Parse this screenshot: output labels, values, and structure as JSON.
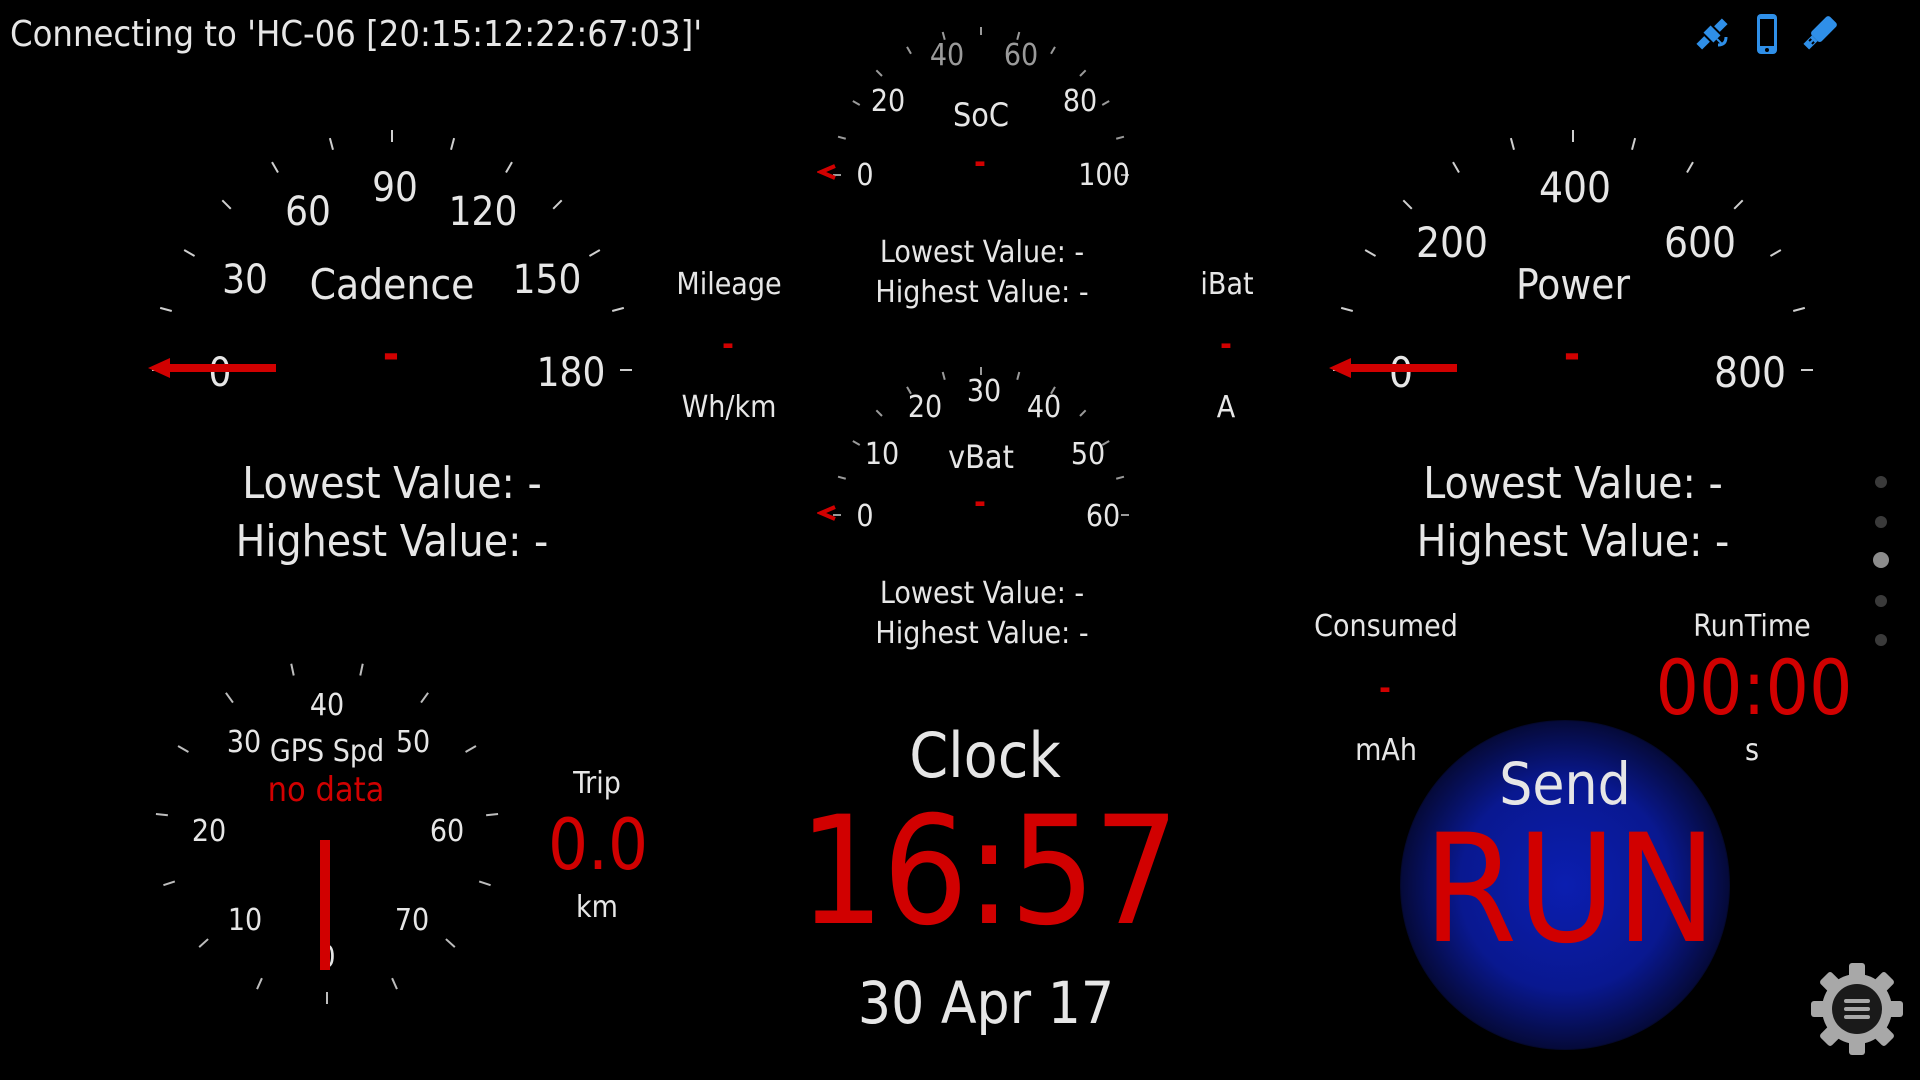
{
  "status": {
    "text": "Connecting to 'HC-06 [20:15:12:22:67:03]'"
  },
  "icons": [
    "satellite-icon",
    "phone-icon",
    "bluetooth-icon",
    "settings-gear-icon"
  ],
  "colors": {
    "accent_red": "#d10000",
    "bg": "#000000",
    "run_blue": "#0b1eb0"
  },
  "cadence": {
    "label": "Cadence",
    "ticks": [
      "0",
      "30",
      "60",
      "90",
      "120",
      "150",
      "180"
    ],
    "value": "-",
    "lowest": "Lowest Value: -",
    "highest": "Highest Value: -"
  },
  "soc": {
    "label": "SoC",
    "ticks": [
      "0",
      "20",
      "40",
      "60",
      "80",
      "100"
    ],
    "value": "-",
    "lowest": "Lowest Value: -",
    "highest": "Highest Value: -"
  },
  "vbat": {
    "label": "vBat",
    "ticks": [
      "0",
      "10",
      "20",
      "30",
      "40",
      "50",
      "60"
    ],
    "value": "-",
    "lowest": "Lowest Value: -",
    "highest": "Highest Value: -"
  },
  "mileage": {
    "label": "Mileage",
    "value": "-",
    "unit": "Wh/km"
  },
  "ibat": {
    "label": "iBat",
    "value": "-",
    "unit": "A"
  },
  "power": {
    "label": "Power",
    "ticks": [
      "0",
      "200",
      "400",
      "600",
      "800"
    ],
    "value": "-",
    "lowest": "Lowest Value: -",
    "highest": "Highest Value: -"
  },
  "gps": {
    "label": "GPS Spd",
    "nodata": "no data",
    "ticks": [
      "0",
      "10",
      "20",
      "30",
      "40",
      "50",
      "60",
      "70"
    ]
  },
  "trip": {
    "label": "Trip",
    "value": "0.0",
    "unit": "km"
  },
  "clock": {
    "label": "Clock",
    "time": "16:57",
    "date": "30 Apr 17"
  },
  "consumed": {
    "label": "Consumed",
    "value": "-",
    "unit": "mAh"
  },
  "runtime": {
    "label": "RunTime",
    "value": "00:00",
    "unit": "s"
  },
  "send": {
    "label": "Send",
    "action": "RUN"
  },
  "page_indicator": {
    "count": 5,
    "active": 3
  }
}
